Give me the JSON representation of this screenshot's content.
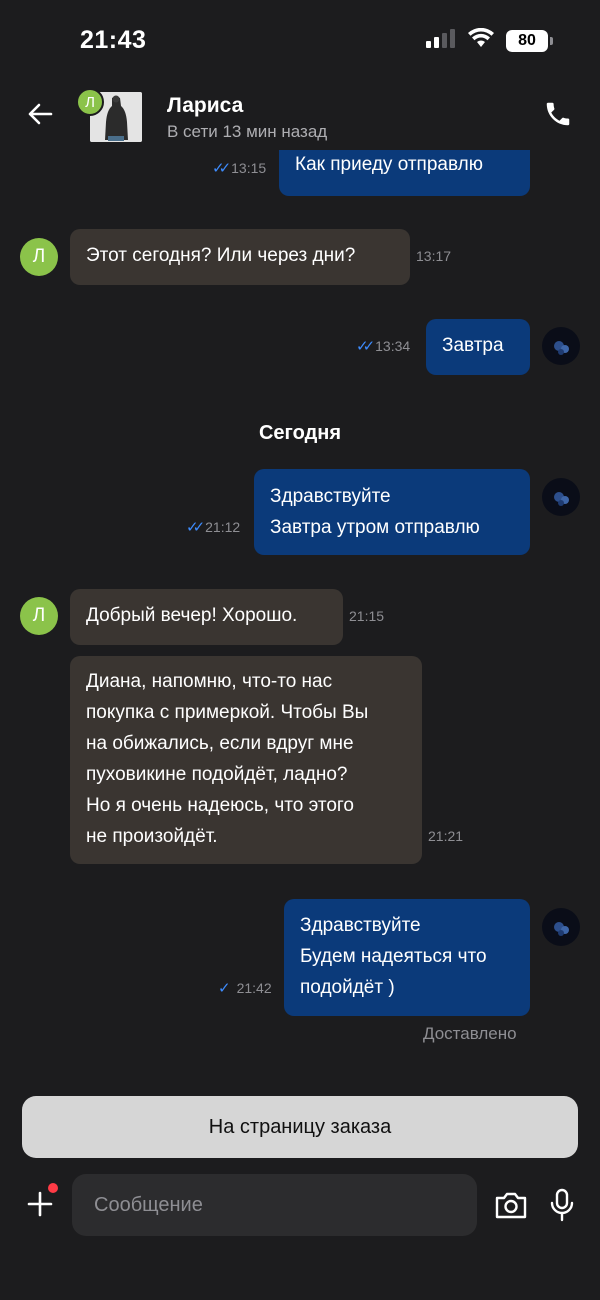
{
  "status_bar": {
    "time": "21:43",
    "battery": "80",
    "icons": [
      "cellular-signal-icon",
      "wifi-icon",
      "battery-icon"
    ]
  },
  "header": {
    "contact_name": "Лариса",
    "contact_status": "В сети 13 мин назад",
    "avatar_letter": "Л",
    "back_icon": "arrow-left-icon",
    "call_icon": "phone-icon"
  },
  "chat": {
    "day_separator": "Сегодня",
    "delivered_label": "Доставлено",
    "messages": [
      {
        "direction": "out",
        "lines": [
          "Как приеду отправлю"
        ],
        "time": "13:15",
        "status": "read"
      },
      {
        "direction": "in",
        "lines": [
          "Этот сегодня? Или через дни?"
        ],
        "time": "13:17"
      },
      {
        "direction": "out",
        "lines": [
          "Завтра"
        ],
        "time": "13:34",
        "status": "read"
      },
      {
        "direction": "out",
        "lines": [
          "Здравствуйте",
          "Завтра утром отправлю"
        ],
        "time": "21:12",
        "status": "read"
      },
      {
        "direction": "in",
        "lines": [
          "Добрый вечер! Хорошо."
        ],
        "time": "21:15"
      },
      {
        "direction": "in",
        "lines": [
          "Диана, напомню, что-то нас",
          "покупка с примеркой. Чтобы Вы",
          "на обижались, если вдруг мне",
          "пуховикине подойдёт, ладно?",
          "Но я очень надеюсь, что этого",
          "не произойдёт."
        ],
        "time": "21:21"
      },
      {
        "direction": "out",
        "lines": [
          "Здравствуйте",
          "Будем надеяться что",
          "подойдёт )"
        ],
        "time": "21:42",
        "status": "sent"
      }
    ]
  },
  "bottom": {
    "order_button": "На страницу заказа",
    "message_placeholder": "Сообщение",
    "accent_dot_color": "#ff3b46"
  },
  "colors": {
    "background": "#1c1c1e",
    "outgoing_bubble": "#0b3a7a",
    "incoming_bubble": "#3a3531",
    "read_check": "#3d8bfd",
    "contact_avatar": "#8bc34a"
  }
}
